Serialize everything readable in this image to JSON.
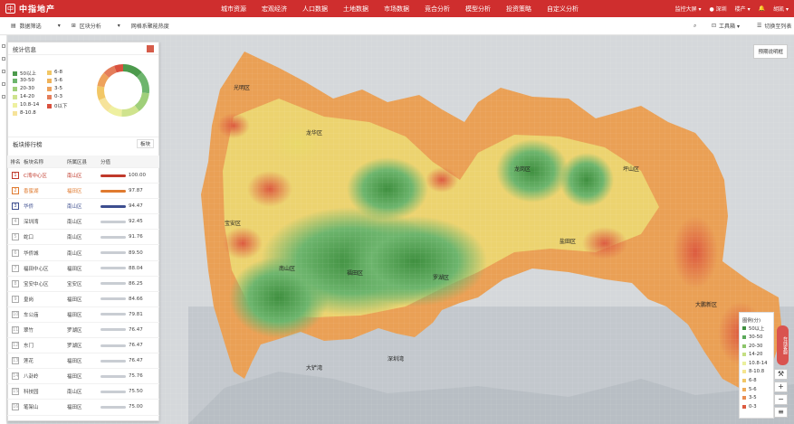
{
  "app": {
    "logo_char": "中",
    "logo_text": "中指地产"
  },
  "nav": [
    "城市资源",
    "宏观经济",
    "人口数据",
    "土地数据",
    "市场数据",
    "竞合分析",
    "模型分析",
    "投资策略",
    "自定义分析"
  ],
  "topright": {
    "screen": "监控大屏 ▾",
    "city": "● 深圳",
    "prop": "楼产 ▾",
    "user": "胡凯 ▾"
  },
  "toolbar": {
    "filter": "数据筛选",
    "block": "区块分析",
    "predict": "网格系聚能热度",
    "tools": "工具箱 ▾",
    "toggle": "切换至列表"
  },
  "map_button": "预期说明框",
  "stats": {
    "title": "统计信息",
    "legend": [
      {
        "label": "50以上",
        "color": "#4c9a4c"
      },
      {
        "label": "6-8",
        "color": "#f2c766"
      },
      {
        "label": "30-50",
        "color": "#6db56d"
      },
      {
        "label": "5-6",
        "color": "#f0b35a"
      },
      {
        "label": "20-30",
        "color": "#9fcf7a"
      },
      {
        "label": "3-5",
        "color": "#eea25b"
      },
      {
        "label": "14-20",
        "color": "#cfe38e"
      },
      {
        "label": "0-3",
        "color": "#e47d5a"
      },
      {
        "label": "10.8-14",
        "color": "#eef0a0"
      },
      {
        "label": "0以下",
        "color": "#d9513e"
      },
      {
        "label": "8-10.8",
        "color": "#f6e39a"
      }
    ]
  },
  "ranking": {
    "title": "板块排行榜",
    "select": "板块",
    "headers": [
      "排名",
      "板块名称",
      "所属区县",
      "分值"
    ],
    "rows": [
      {
        "rank": "1",
        "name": "C湾中心区",
        "district": "南山区",
        "score": "100.00",
        "color": "#c0392b"
      },
      {
        "rank": "2",
        "name": "香蜜湖",
        "district": "福田区",
        "score": "97.87",
        "color": "#e07a2f"
      },
      {
        "rank": "3",
        "name": "华侨",
        "district": "南山区",
        "score": "94.47",
        "color": "#3d4e8f"
      },
      {
        "rank": "4",
        "name": "深圳湾",
        "district": "南山区",
        "score": "92.45",
        "color": "#c9cdd3"
      },
      {
        "rank": "5",
        "name": "蛇口",
        "district": "南山区",
        "score": "91.76",
        "color": "#c9cdd3"
      },
      {
        "rank": "6",
        "name": "华侨城",
        "district": "南山区",
        "score": "89.50",
        "color": "#c9cdd3"
      },
      {
        "rank": "7",
        "name": "福田中心区",
        "district": "福田区",
        "score": "88.04",
        "color": "#c9cdd3"
      },
      {
        "rank": "8",
        "name": "宝安中心区",
        "district": "宝安区",
        "score": "86.25",
        "color": "#c9cdd3"
      },
      {
        "rank": "9",
        "name": "皇岗",
        "district": "福田区",
        "score": "84.66",
        "color": "#c9cdd3"
      },
      {
        "rank": "10",
        "name": "车公庙",
        "district": "福田区",
        "score": "79.81",
        "color": "#c9cdd3"
      },
      {
        "rank": "11",
        "name": "翠竹",
        "district": "罗湖区",
        "score": "76.47",
        "color": "#c9cdd3"
      },
      {
        "rank": "12",
        "name": "东门",
        "district": "罗湖区",
        "score": "76.47",
        "color": "#c9cdd3"
      },
      {
        "rank": "13",
        "name": "莲花",
        "district": "福田区",
        "score": "76.47",
        "color": "#c9cdd3"
      },
      {
        "rank": "14",
        "name": "八卦岭",
        "district": "福田区",
        "score": "75.76",
        "color": "#c9cdd3"
      },
      {
        "rank": "15",
        "name": "科技园",
        "district": "南山区",
        "score": "75.50",
        "color": "#c9cdd3"
      },
      {
        "rank": "16",
        "name": "笔架山",
        "district": "福田区",
        "score": "75.00",
        "color": "#c9cdd3"
      }
    ]
  },
  "map_legend": {
    "title": "图例(分)",
    "items": [
      {
        "label": "50以上",
        "color": "#3f8f3f"
      },
      {
        "label": "30-50",
        "color": "#5aa85a"
      },
      {
        "label": "20-30",
        "color": "#8cc56a"
      },
      {
        "label": "14-20",
        "color": "#c4df83"
      },
      {
        "label": "10.8-14",
        "color": "#eaf09d"
      },
      {
        "label": "8-10.8",
        "color": "#f6e58f"
      },
      {
        "label": "6-8",
        "color": "#f2c766"
      },
      {
        "label": "5-6",
        "color": "#efac58"
      },
      {
        "label": "3-5",
        "color": "#e98d50"
      },
      {
        "label": "0-3",
        "color": "#dc5a3f"
      }
    ]
  },
  "map_tab": "在线客服",
  "district_labels": [
    "光明区",
    "龙华区",
    "宝安区",
    "南山区",
    "福田区",
    "罗湖区",
    "龙岗区",
    "坪山区",
    "盐田区",
    "大鹏新区",
    "深圳湾",
    "大铲湾"
  ]
}
